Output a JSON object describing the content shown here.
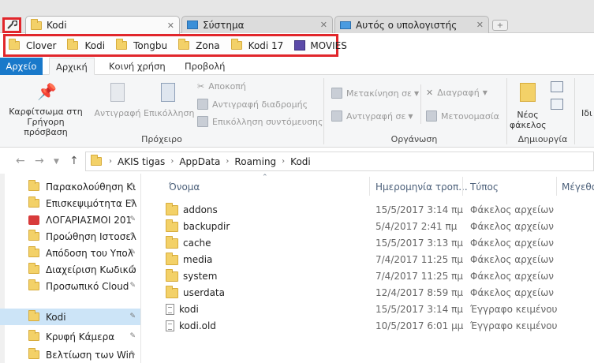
{
  "tabs": [
    {
      "label": "Kodi",
      "icon": "folder-icon",
      "active": true
    },
    {
      "label": "Σύστημα",
      "icon": "system-icon",
      "active": false
    },
    {
      "label": "Αυτός ο υπολογιστής",
      "icon": "computer-icon",
      "active": false
    }
  ],
  "bookmarks": [
    {
      "label": "Clover",
      "icon": "folder-icon"
    },
    {
      "label": "Kodi",
      "icon": "folder-icon"
    },
    {
      "label": "Tongbu",
      "icon": "folder-icon"
    },
    {
      "label": "Zona",
      "icon": "folder-icon"
    },
    {
      "label": "Kodi 17",
      "icon": "folder-icon"
    },
    {
      "label": "MOVIES",
      "icon": "film-icon"
    }
  ],
  "ribbon_tabs": {
    "file": "Αρχείο",
    "home": "Αρχική",
    "share": "Κοινή χρήση",
    "view": "Προβολή"
  },
  "ribbon": {
    "clipboard": {
      "pin": "Καρφίτσωμα στη Γρήγορη πρόσβαση",
      "copy": "Αντιγραφή",
      "paste": "Επικόλληση",
      "cut": "Αποκοπή",
      "copy_path": "Αντιγραφή διαδρομής",
      "paste_shortcut": "Επικόλληση συντόμευσης",
      "group": "Πρόχειρο"
    },
    "organize": {
      "move_to": "Μετακίνηση σε",
      "copy_to": "Αντιγραφή σε",
      "delete": "Διαγραφή",
      "rename": "Μετονομασία",
      "group": "Οργάνωση"
    },
    "new": {
      "new_folder": "Νέος φάκελος",
      "group": "Δημιουργία"
    },
    "props_cut": "Ιδι"
  },
  "address": {
    "crumbs": [
      "AKIS tigas",
      "AppData",
      "Roaming",
      "Kodi"
    ]
  },
  "nav_pane": [
    {
      "label": "Παρακολούθηση Κι",
      "icon": "folder-icon",
      "selected": false
    },
    {
      "label": "Επισκεψιμότητα Ελ",
      "icon": "folder-icon",
      "selected": false
    },
    {
      "label": "ΛΟΓΑΡΙΑΣΜΟΙ  201",
      "icon": "excel-icon",
      "selected": false
    },
    {
      "label": "Προώθηση Ιστοσελ",
      "icon": "folder-icon",
      "selected": false
    },
    {
      "label": "Απόδοση του Υπολ",
      "icon": "folder-icon",
      "selected": false
    },
    {
      "label": "Διαχείριση Κωδικώ",
      "icon": "folder-icon",
      "selected": false
    },
    {
      "label": "Προσωπικό Cloud",
      "icon": "folder-icon",
      "selected": false
    },
    {
      "label": "Kodi",
      "icon": "folder-icon",
      "selected": true
    },
    {
      "label": "Κρυφή Κάμερα",
      "icon": "folder-icon",
      "selected": false
    },
    {
      "label": "Βελτίωση των Win",
      "icon": "folder-icon",
      "selected": false
    }
  ],
  "columns": {
    "name": "Όνομα",
    "date": "Ημερομηνία τροπ...",
    "type": "Τύπος",
    "size": "Μέγεθο"
  },
  "files": [
    {
      "name": "addons",
      "date": "15/5/2017 3:14 πμ",
      "type": "Φάκελος αρχείων",
      "icon": "folder-icon"
    },
    {
      "name": "backupdir",
      "date": "5/4/2017 2:41 πμ",
      "type": "Φάκελος αρχείων",
      "icon": "folder-icon"
    },
    {
      "name": "cache",
      "date": "15/5/2017 3:13 πμ",
      "type": "Φάκελος αρχείων",
      "icon": "folder-icon"
    },
    {
      "name": "media",
      "date": "7/4/2017 11:25 πμ",
      "type": "Φάκελος αρχείων",
      "icon": "folder-icon"
    },
    {
      "name": "system",
      "date": "7/4/2017 11:25 πμ",
      "type": "Φάκελος αρχείων",
      "icon": "folder-icon"
    },
    {
      "name": "userdata",
      "date": "12/4/2017 8:59 πμ",
      "type": "Φάκελος αρχείων",
      "icon": "folder-icon"
    },
    {
      "name": "kodi",
      "date": "15/5/2017 3:14 πμ",
      "type": "Έγγραφο κειμένου",
      "icon": "text-file-icon"
    },
    {
      "name": "kodi.old",
      "date": "10/5/2017 6:01 μμ",
      "type": "Έγγραφο κειμένου",
      "icon": "text-file-icon"
    }
  ],
  "colors": {
    "accent": "#1979ca",
    "highlight": "#e1262b",
    "selected": "#cce4f7"
  }
}
